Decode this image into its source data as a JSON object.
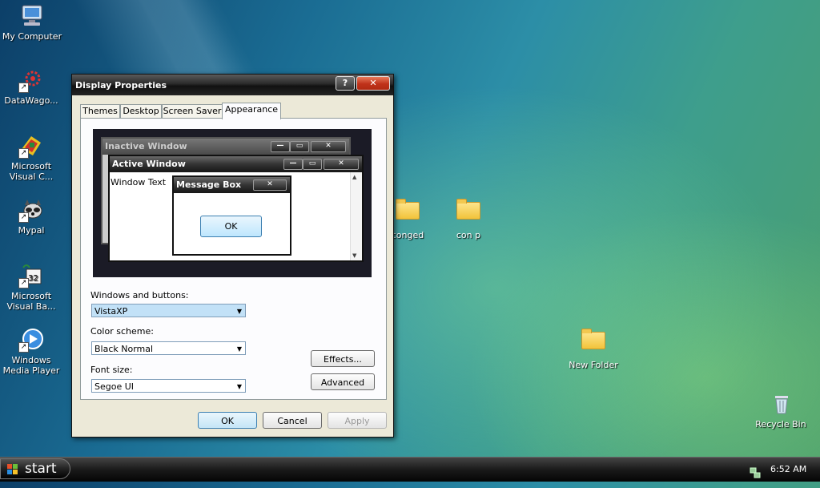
{
  "desktop": {
    "icons": [
      {
        "label": "My Computer"
      },
      {
        "label": "DataWago..."
      },
      {
        "label": "Microsoft Visual C..."
      },
      {
        "label": "Mypal"
      },
      {
        "label": "Microsoft Visual Ba..."
      },
      {
        "label": "Windows Media Player"
      },
      {
        "label": "conged"
      },
      {
        "label": "con p"
      },
      {
        "label": "New Folder"
      },
      {
        "label": "Recycle Bin"
      }
    ]
  },
  "dialog": {
    "title": "Display Properties",
    "help_label": "?",
    "close_label": "✕",
    "tabs": [
      {
        "label": "Themes"
      },
      {
        "label": "Desktop"
      },
      {
        "label": "Screen Saver"
      },
      {
        "label": "Appearance"
      }
    ],
    "preview": {
      "inactive_title": "Inactive Window",
      "active_title": "Active Window",
      "window_text": "Window Text",
      "message_title": "Message Box",
      "message_ok": "OK"
    },
    "windows_buttons_label": "Windows and buttons:",
    "windows_buttons_value": "VistaXP",
    "color_scheme_label": "Color scheme:",
    "color_scheme_value": "Black Normal",
    "font_size_label": "Font size:",
    "font_size_value": "Segoe UI",
    "effects_label": "Effects...",
    "advanced_label": "Advanced",
    "ok_label": "OK",
    "cancel_label": "Cancel",
    "apply_label": "Apply"
  },
  "taskbar": {
    "start_label": "start",
    "clock": "6:52 AM"
  }
}
